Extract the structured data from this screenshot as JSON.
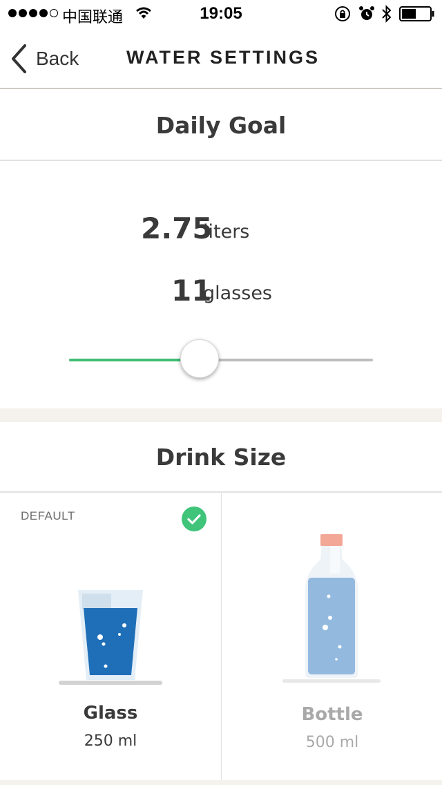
{
  "status_bar": {
    "carrier": "中国联通",
    "time": "19:05"
  },
  "nav": {
    "back_label": "Back",
    "title": "WATER SETTINGS"
  },
  "daily_goal": {
    "header": "Daily Goal",
    "liters_value": "2.75",
    "liters_unit": "liters",
    "glasses_value": "11",
    "glasses_unit": "glasses",
    "slider_fraction": 0.43,
    "slider_fill_color": "#3fbd73"
  },
  "drink_size": {
    "header": "Drink Size",
    "options": [
      {
        "default_label": "DEFAULT",
        "name": "Glass",
        "size": "250 ml",
        "selected": true,
        "check_color": "#3fc47a"
      },
      {
        "name": "Bottle",
        "size": "500 ml",
        "selected": false
      }
    ]
  },
  "icons": {
    "back": "chevron-left-icon",
    "wifi": "wifi-icon",
    "lock": "rotation-lock-icon",
    "alarm": "alarm-icon",
    "bluetooth": "bluetooth-icon",
    "battery": "battery-icon",
    "check": "check-circle-icon",
    "glass": "glass-of-water-icon",
    "bottle": "water-bottle-icon"
  }
}
